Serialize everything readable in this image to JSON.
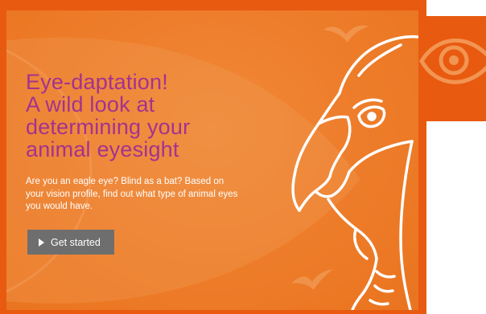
{
  "hero": {
    "headline_lines": [
      "Eye-daptation!",
      "A wild look at",
      "determining your",
      "animal eyesight"
    ],
    "description": "Are you an eagle eye? Blind as a bat? Based on your vision profile, find out what type of animal eyes you would have.",
    "cta_label": "Get started",
    "cta_icon": "play-icon"
  },
  "decor": {
    "main_illustration": "bird-head-outline-illustration",
    "corner_icon": "eye-icon",
    "background_shapes": [
      "bird-silhouette",
      "fish-shape"
    ]
  },
  "colors": {
    "frame": "#e85a10",
    "card": "#ee7e2c",
    "headline": "#a4328f",
    "button": "#6e6e6e",
    "text": "#ffffff"
  }
}
